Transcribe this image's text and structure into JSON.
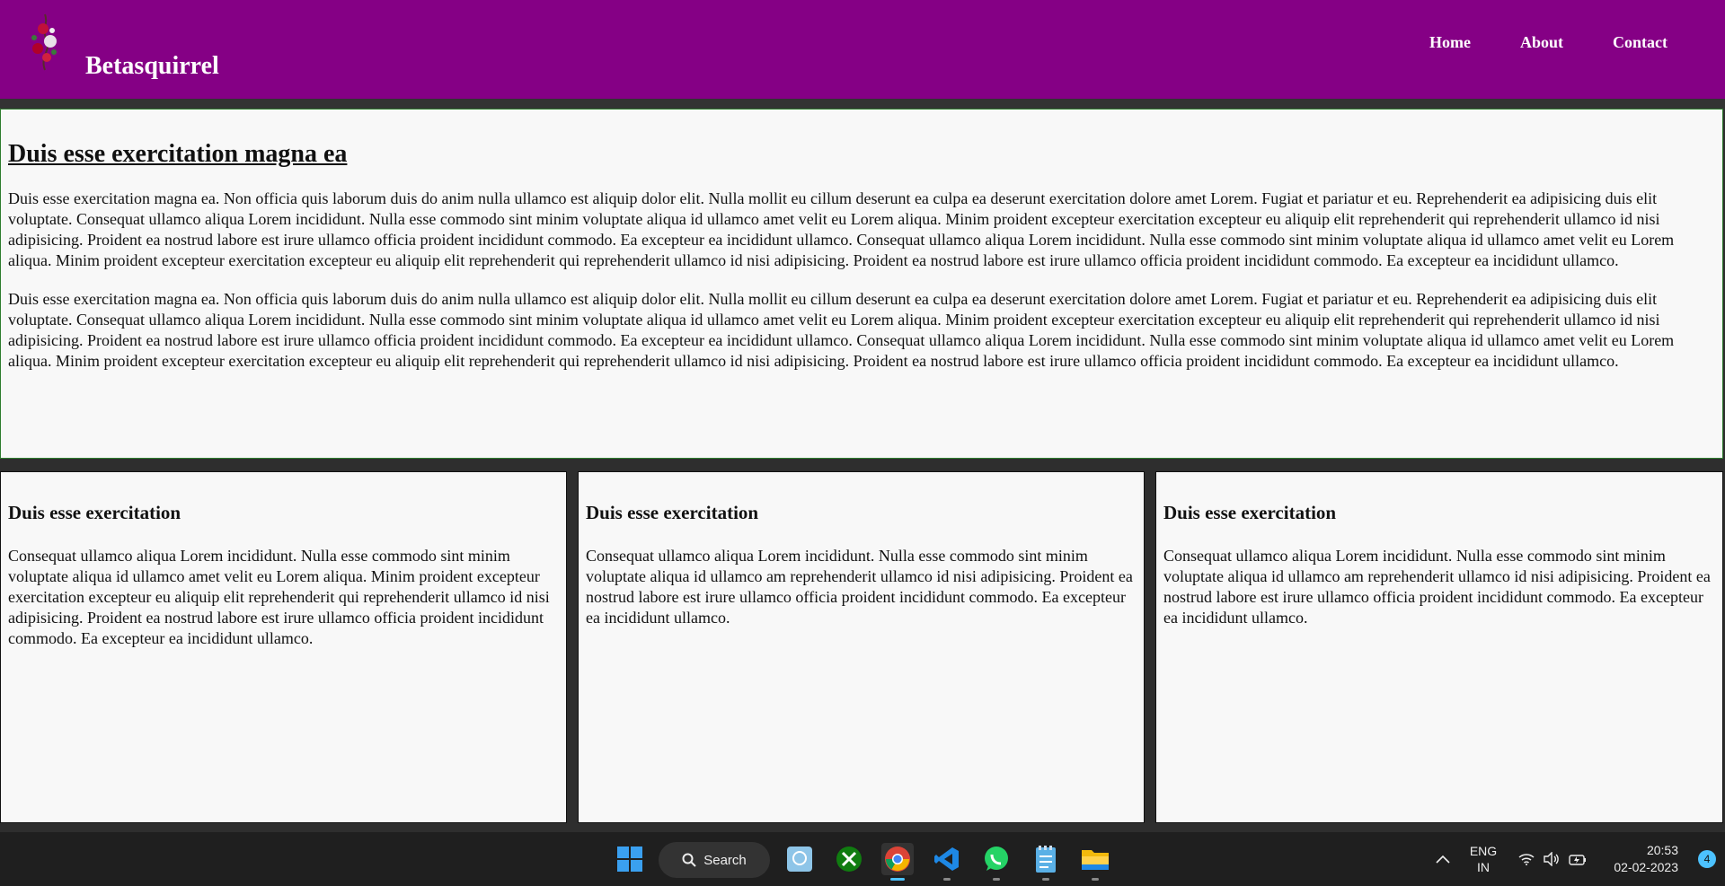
{
  "header": {
    "brand": "Betasquirrel",
    "nav": [
      "Home",
      "About",
      "Contact"
    ]
  },
  "article": {
    "title": "Duis esse exercitation magna ea",
    "paragraphs": [
      "Duis esse exercitation magna ea. Non officia quis laborum duis do anim nulla ullamco est aliquip dolor elit. Nulla mollit eu cillum deserunt ea culpa ea deserunt exercitation dolore amet Lorem. Fugiat et pariatur et eu. Reprehenderit ea adipisicing duis elit voluptate. Consequat ullamco aliqua Lorem incididunt. Nulla esse commodo sint minim voluptate aliqua id ullamco amet velit eu Lorem aliqua. Minim proident excepteur exercitation excepteur eu aliquip elit reprehenderit qui reprehenderit ullamco id nisi adipisicing. Proident ea nostrud labore est irure ullamco officia proident incididunt commodo. Ea excepteur ea incididunt ullamco. Consequat ullamco aliqua Lorem incididunt. Nulla esse commodo sint minim voluptate aliqua id ullamco amet velit eu Lorem aliqua. Minim proident excepteur exercitation excepteur eu aliquip elit reprehenderit qui reprehenderit ullamco id nisi adipisicing. Proident ea nostrud labore est irure ullamco officia proident incididunt commodo. Ea excepteur ea incididunt ullamco.",
      "Duis esse exercitation magna ea. Non officia quis laborum duis do anim nulla ullamco est aliquip dolor elit. Nulla mollit eu cillum deserunt ea culpa ea deserunt exercitation dolore amet Lorem. Fugiat et pariatur et eu. Reprehenderit ea adipisicing duis elit voluptate. Consequat ullamco aliqua Lorem incididunt. Nulla esse commodo sint minim voluptate aliqua id ullamco amet velit eu Lorem aliqua. Minim proident excepteur exercitation excepteur eu aliquip elit reprehenderit qui reprehenderit ullamco id nisi adipisicing. Proident ea nostrud labore est irure ullamco officia proident incididunt commodo. Ea excepteur ea incididunt ullamco. Consequat ullamco aliqua Lorem incididunt. Nulla esse commodo sint minim voluptate aliqua id ullamco amet velit eu Lorem aliqua. Minim proident excepteur exercitation excepteur eu aliquip elit reprehenderit qui reprehenderit ullamco id nisi adipisicing. Proident ea nostrud labore est irure ullamco officia proident incididunt commodo. Ea excepteur ea incididunt ullamco."
    ]
  },
  "cards": [
    {
      "title": "Duis esse exercitation",
      "text": "Consequat ullamco aliqua Lorem incididunt. Nulla esse commodo sint minim voluptate aliqua id ullamco amet velit eu Lorem aliqua. Minim proident excepteur exercitation excepteur eu aliquip elit reprehenderit qui reprehenderit ullamco id nisi adipisicing. Proident ea nostrud labore est irure ullamco officia proident incididunt commodo. Ea excepteur ea incididunt ullamco."
    },
    {
      "title": "Duis esse exercitation",
      "text": "Consequat ullamco aliqua Lorem incididunt. Nulla esse commodo sint minim voluptate aliqua id ullamco am reprehenderit ullamco id nisi adipisicing. Proident ea nostrud labore est irure ullamco officia proident incididunt commodo. Ea excepteur ea incididunt ullamco."
    },
    {
      "title": "Duis esse exercitation",
      "text": "Consequat ullamco aliqua Lorem incididunt. Nulla esse commodo sint minim voluptate aliqua id ullamco am reprehenderit ullamco id nisi adipisicing. Proident ea nostrud labore est irure ullamco officia proident incididunt commodo. Ea excepteur ea incididunt ullamco."
    }
  ],
  "taskbar": {
    "search_label": "Search",
    "language_line1": "ENG",
    "language_line2": "IN",
    "time": "20:53",
    "date": "02-02-2023",
    "notification_count": "4",
    "pinned_apps": [
      "windows-start-icon",
      "photos-icon",
      "xbox-icon",
      "chrome-icon",
      "vscode-icon",
      "whatsapp-icon",
      "notepad-icon",
      "file-explorer-icon"
    ]
  },
  "colors": {
    "header_bg": "#850085",
    "page_bg": "#2e2e2e",
    "panel_bg": "#f8f8f8",
    "article_border": "#2f7d2f",
    "taskbar_bg": "#1f1f1f",
    "accent": "#4cc2ff"
  }
}
